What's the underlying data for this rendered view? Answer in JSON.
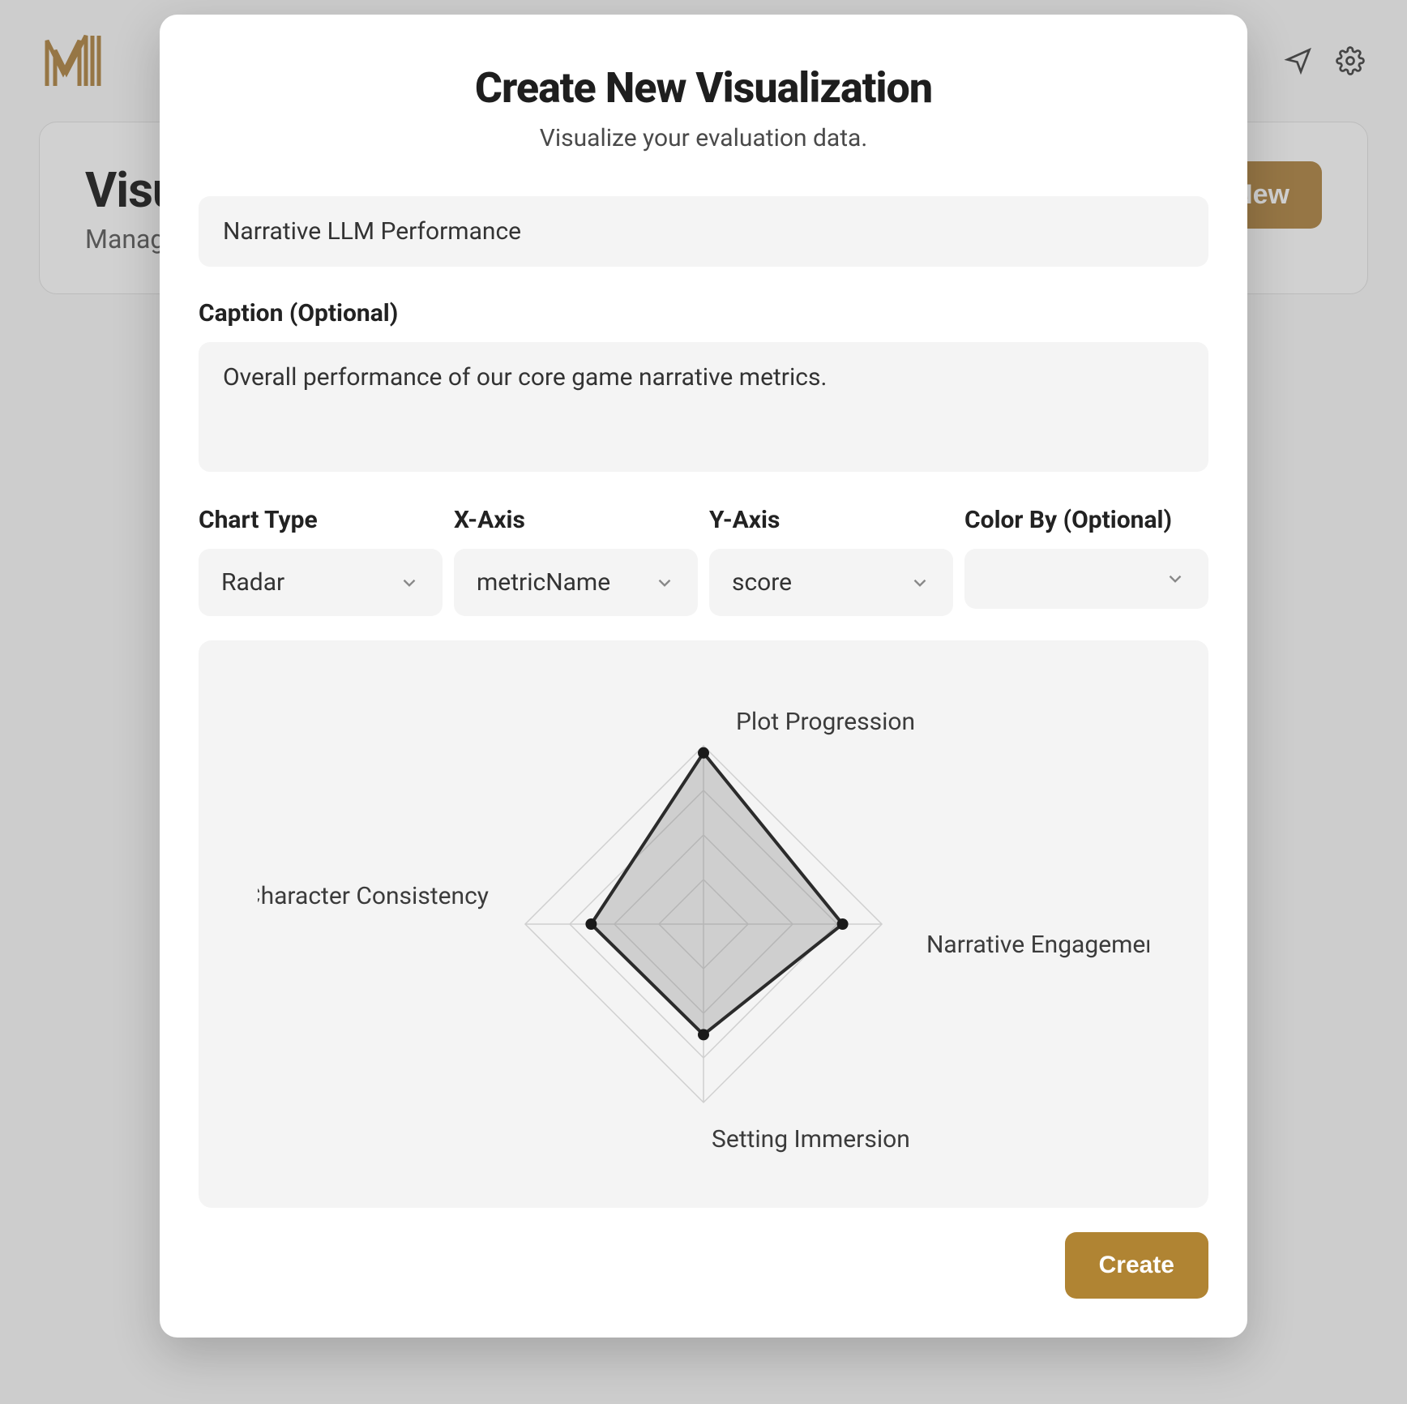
{
  "background": {
    "page_title": "Visua",
    "page_subtitle": "Manage",
    "new_button": "New"
  },
  "modal": {
    "title": "Create New Visualization",
    "subtitle": "Visualize your evaluation data.",
    "name_value": "Narrative LLM Performance",
    "caption_label": "Caption (Optional)",
    "caption_value": "Overall performance of our core game narrative metrics.",
    "selects": {
      "chart_type": {
        "label": "Chart Type",
        "value": "Radar"
      },
      "x_axis": {
        "label": "X-Axis",
        "value": "metricName"
      },
      "y_axis": {
        "label": "Y-Axis",
        "value": "score"
      },
      "color_by": {
        "label": "Color By (Optional)",
        "value": ""
      }
    },
    "create_button": "Create"
  },
  "chart_data": {
    "type": "radar",
    "title": "",
    "categories": [
      "Plot Progression",
      "Narrative Engagement",
      "Setting Immersion",
      "Character Consistency"
    ],
    "values": [
      0.96,
      0.78,
      0.62,
      0.63
    ],
    "range": [
      0,
      1
    ],
    "rings": 4
  },
  "colors": {
    "accent": "#b08433",
    "muted_bg": "#f4f4f4"
  }
}
